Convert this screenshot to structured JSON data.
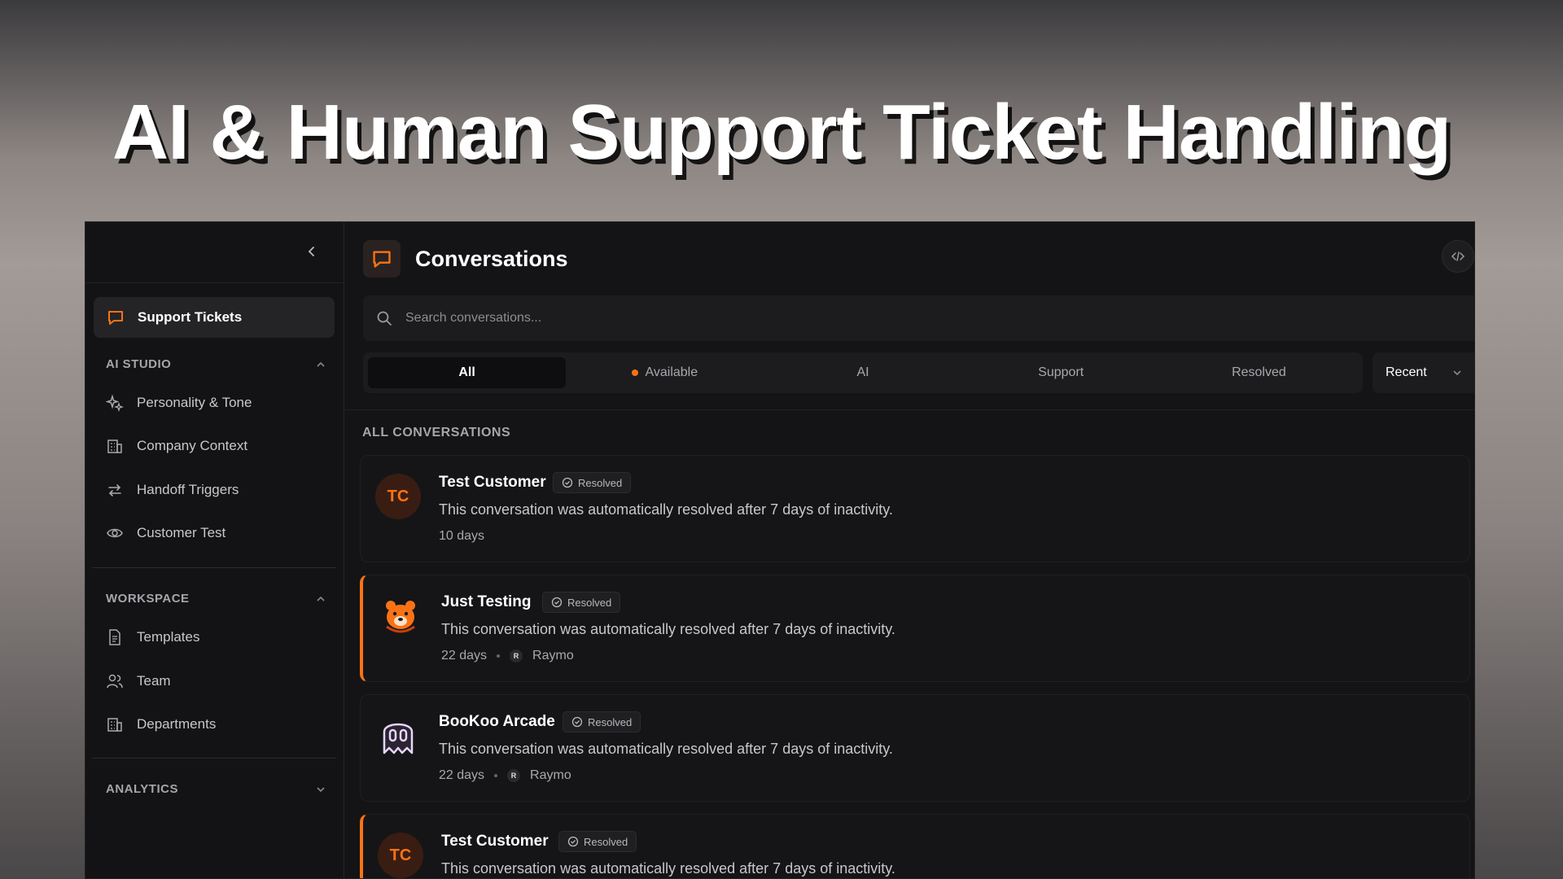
{
  "hero": {
    "title": "AI & Human Support Ticket Handling"
  },
  "sidebar": {
    "active_item": {
      "label": "Support Tickets",
      "icon": "chat-bubble-icon"
    },
    "sections": [
      {
        "title": "AI STUDIO",
        "expanded": true,
        "items": [
          {
            "label": "Personality & Tone",
            "icon": "sparkles-icon"
          },
          {
            "label": "Company Context",
            "icon": "building-icon"
          },
          {
            "label": "Handoff Triggers",
            "icon": "arrows-swap-icon"
          },
          {
            "label": "Customer Test",
            "icon": "eye-icon"
          }
        ]
      },
      {
        "title": "WORKSPACE",
        "expanded": true,
        "items": [
          {
            "label": "Templates",
            "icon": "document-icon"
          },
          {
            "label": "Team",
            "icon": "users-icon"
          },
          {
            "label": "Departments",
            "icon": "building-icon"
          }
        ]
      },
      {
        "title": "ANALYTICS",
        "expanded": false,
        "items": []
      }
    ]
  },
  "main": {
    "title": "Conversations",
    "search": {
      "placeholder": "Search conversations..."
    },
    "filters": [
      {
        "label": "All",
        "active": true,
        "dot": false
      },
      {
        "label": "Available",
        "active": false,
        "dot": true
      },
      {
        "label": "AI",
        "active": false,
        "dot": false
      },
      {
        "label": "Support",
        "active": false,
        "dot": false
      },
      {
        "label": "Resolved",
        "active": false,
        "dot": false
      }
    ],
    "sort": {
      "selected": "Recent"
    },
    "list_label": "ALL CONVERSATIONS",
    "conversations": [
      {
        "name": "Test Customer",
        "initials": "TC",
        "status": "Resolved",
        "message": "This conversation was automatically resolved after 7 days of inactivity.",
        "age": "10 days",
        "agent": null,
        "agent_initial": null
      },
      {
        "name": "Just Testing",
        "initials": null,
        "status": "Resolved",
        "message": "This conversation was automatically resolved after 7 days of inactivity.",
        "age": "22 days",
        "agent": "Raymo",
        "agent_initial": "R"
      },
      {
        "name": "BooKoo Arcade",
        "initials": null,
        "status": "Resolved",
        "message": "This conversation was automatically resolved after 7 days of inactivity.",
        "age": "22 days",
        "agent": "Raymo",
        "agent_initial": "R"
      },
      {
        "name": "Test Customer",
        "initials": "TC",
        "status": "Resolved",
        "message": "This conversation was automatically resolved after 7 days of inactivity.",
        "age": "",
        "agent": null,
        "agent_initial": null
      }
    ]
  },
  "colors": {
    "accent": "#f97316",
    "background": "#141416"
  }
}
